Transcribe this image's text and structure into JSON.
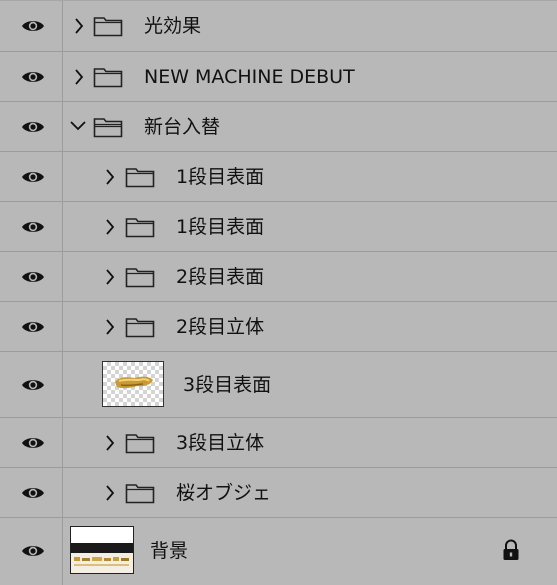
{
  "layers": [
    {
      "label": "光効果",
      "expanded": false,
      "visible": true,
      "icon": "folder-icon"
    },
    {
      "label": "NEW MACHINE DEBUT",
      "expanded": false,
      "visible": true,
      "icon": "folder-icon"
    },
    {
      "label": "新台入替",
      "expanded": true,
      "visible": true,
      "icon": "folder-open-icon"
    },
    {
      "label": "1段目表面",
      "expanded": false,
      "visible": true,
      "icon": "folder-icon"
    },
    {
      "label": "1段目表面",
      "expanded": false,
      "visible": true,
      "icon": "folder-icon"
    },
    {
      "label": "2段目表面",
      "expanded": false,
      "visible": true,
      "icon": "folder-icon"
    },
    {
      "label": "2段目立体",
      "expanded": false,
      "visible": true,
      "icon": "folder-icon"
    },
    {
      "label": "3段目表面",
      "visible": true,
      "icon": "layer-thumbnail"
    },
    {
      "label": "3段目立体",
      "expanded": false,
      "visible": true,
      "icon": "folder-icon"
    },
    {
      "label": "桜オブジェ",
      "expanded": false,
      "visible": true,
      "icon": "folder-icon"
    },
    {
      "label": "背景",
      "visible": true,
      "locked": true,
      "icon": "layer-thumbnail"
    }
  ],
  "colors": {
    "panel_bg": "#b8b8b8",
    "divider": "#9c9c9c",
    "text": "#111111",
    "gold": "#d4a53a"
  }
}
